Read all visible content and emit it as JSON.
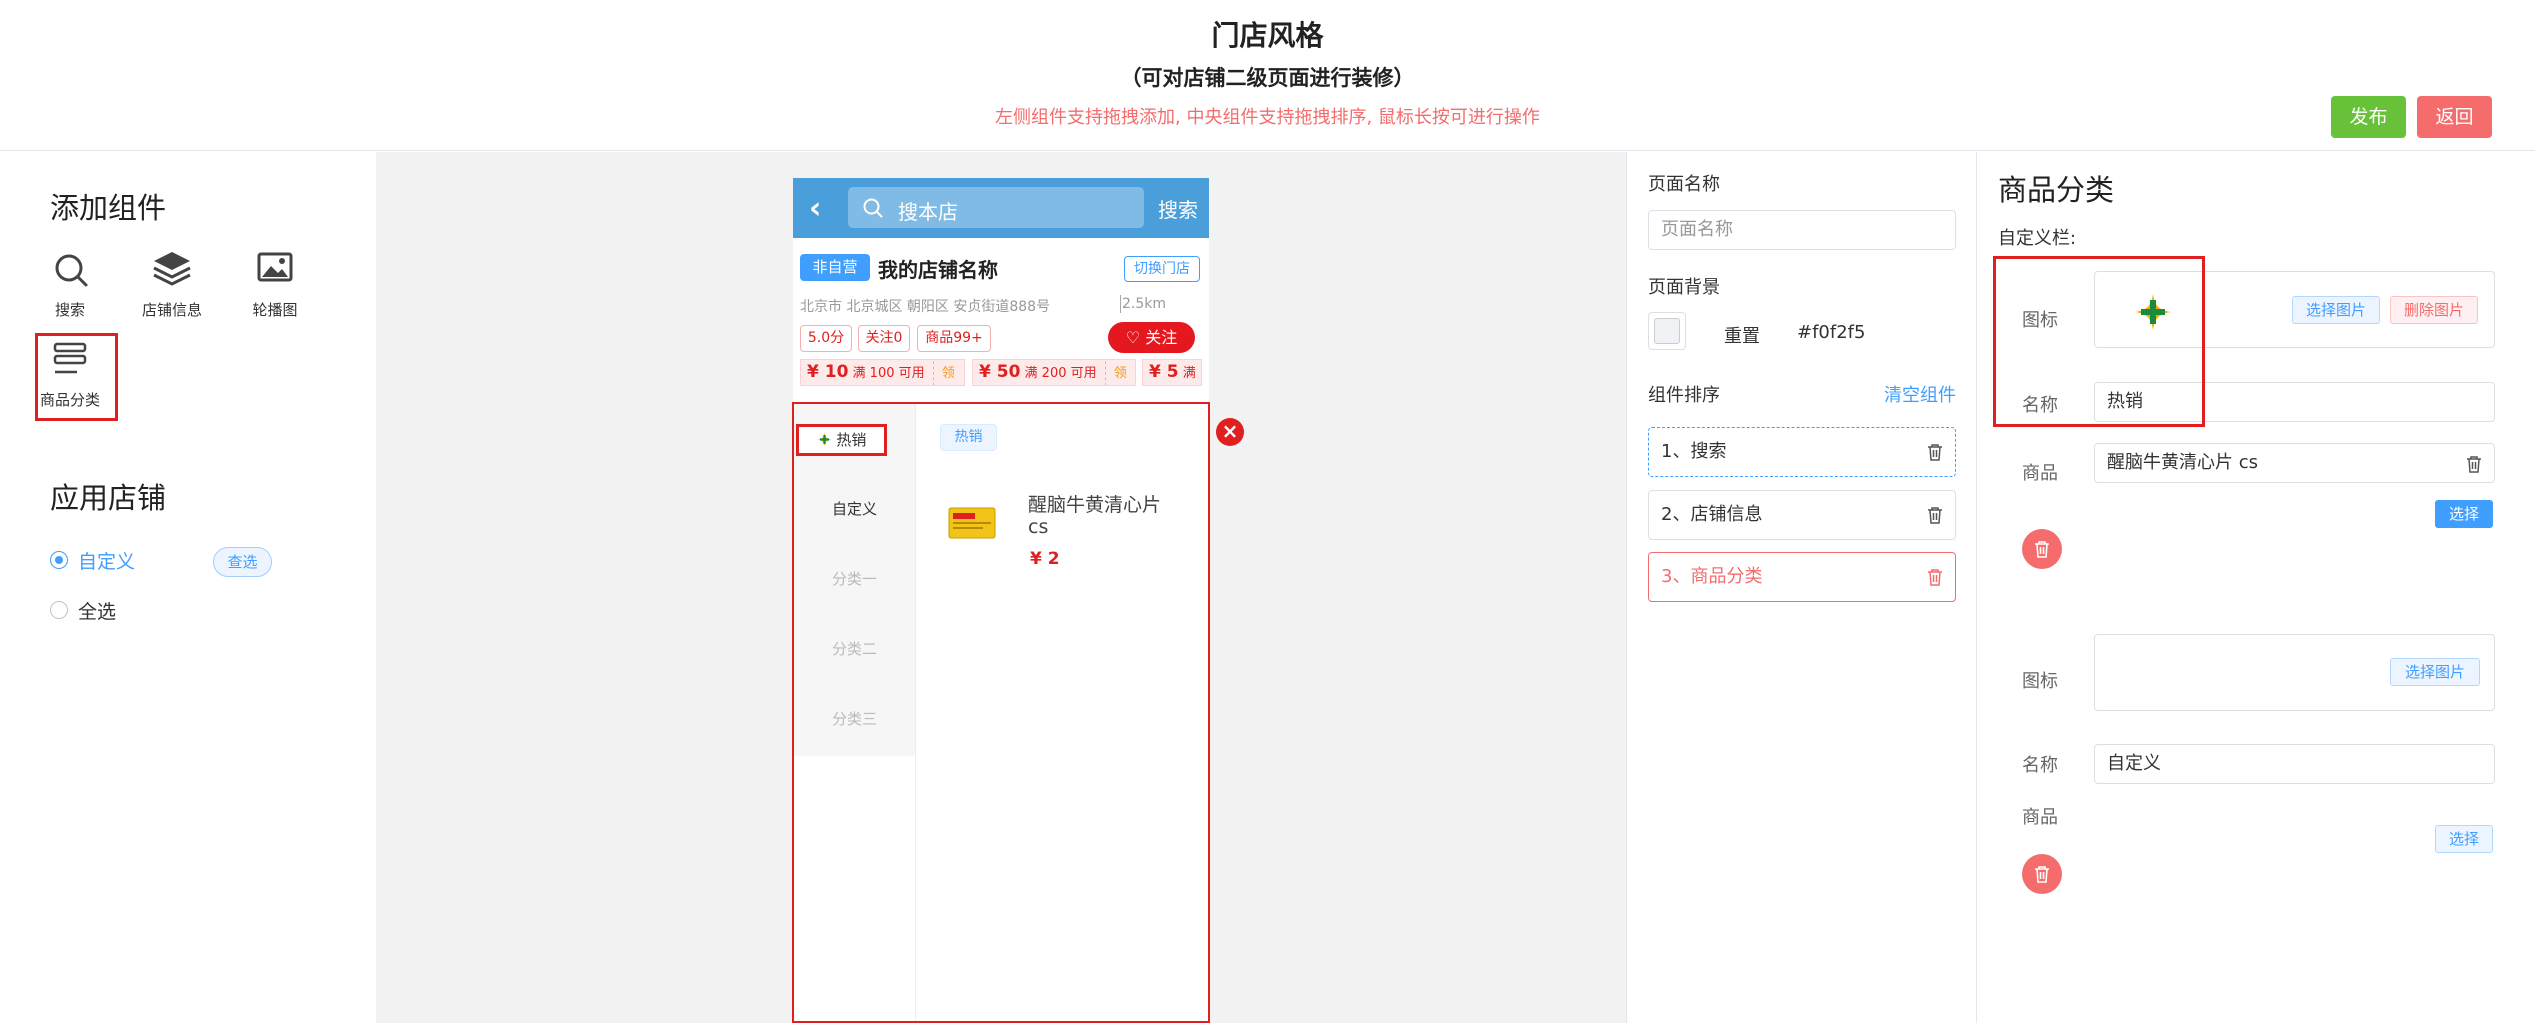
{
  "header": {
    "title": "门店风格",
    "subtitle": "（可对店铺二级页面进行装修）",
    "tip": "左侧组件支持拖拽添加, 中央组件支持拖拽排序, 鼠标长按可进行操作",
    "publish_label": "发布",
    "back_label": "返回",
    "colors": {
      "publish": "#67c23a",
      "back": "#f56c6c"
    }
  },
  "left": {
    "add_title": "添加组件",
    "components": [
      {
        "label": "搜索",
        "icon": "search-icon"
      },
      {
        "label": "店铺信息",
        "icon": "layers-icon"
      },
      {
        "label": "轮播图",
        "icon": "image-icon"
      },
      {
        "label": "商品分类",
        "icon": "list-icon"
      }
    ],
    "apply_title": "应用店铺",
    "options": [
      {
        "label": "自定义",
        "selected": true
      },
      {
        "label": "全选",
        "selected": false
      }
    ],
    "check_label": "查选"
  },
  "phone": {
    "search": {
      "placeholder": "搜本店",
      "button": "搜索"
    },
    "shop": {
      "badge": "非自营",
      "name": "我的店铺名称",
      "switch": "切换门店",
      "address": "北京市 北京城区 朝阳区 安贞街道888号",
      "distance": "2.5km",
      "stats": [
        "5.0分",
        "关注0",
        "商品99+"
      ],
      "follow": "关注"
    },
    "coupons": [
      {
        "amount": "¥ 10",
        "cond": "满 100 可用",
        "get": "领"
      },
      {
        "amount": "¥ 50",
        "cond": "满 200 可用",
        "get": "领"
      },
      {
        "amount": "¥ 5",
        "cond": "满"
      }
    ],
    "categories": [
      "热销",
      "自定义",
      "分类一",
      "分类二",
      "分类三"
    ],
    "active_tag": "热销",
    "product": {
      "name": "醒脑牛黄清心片 cs",
      "price": "¥ 2"
    }
  },
  "settings": {
    "page_name_label": "页面名称",
    "page_name_placeholder": "页面名称",
    "bg_label": "页面背景",
    "reset_label": "重置",
    "bg_value": "#f0f2f5",
    "sort_label": "组件排序",
    "clear_label": "清空组件",
    "sort_items": [
      "1、搜索",
      "2、店铺信息",
      "3、商品分类"
    ]
  },
  "right": {
    "title": "商品分类",
    "custom_label": "自定义栏:",
    "icon_label": "图标",
    "name_label": "名称",
    "product_label": "商品",
    "choose_image": "选择图片",
    "delete_image": "删除图片",
    "choose": "选择",
    "groups": [
      {
        "name": "热销",
        "product": "醒脑牛黄清心片 cs"
      },
      {
        "name": "自定义"
      }
    ]
  }
}
